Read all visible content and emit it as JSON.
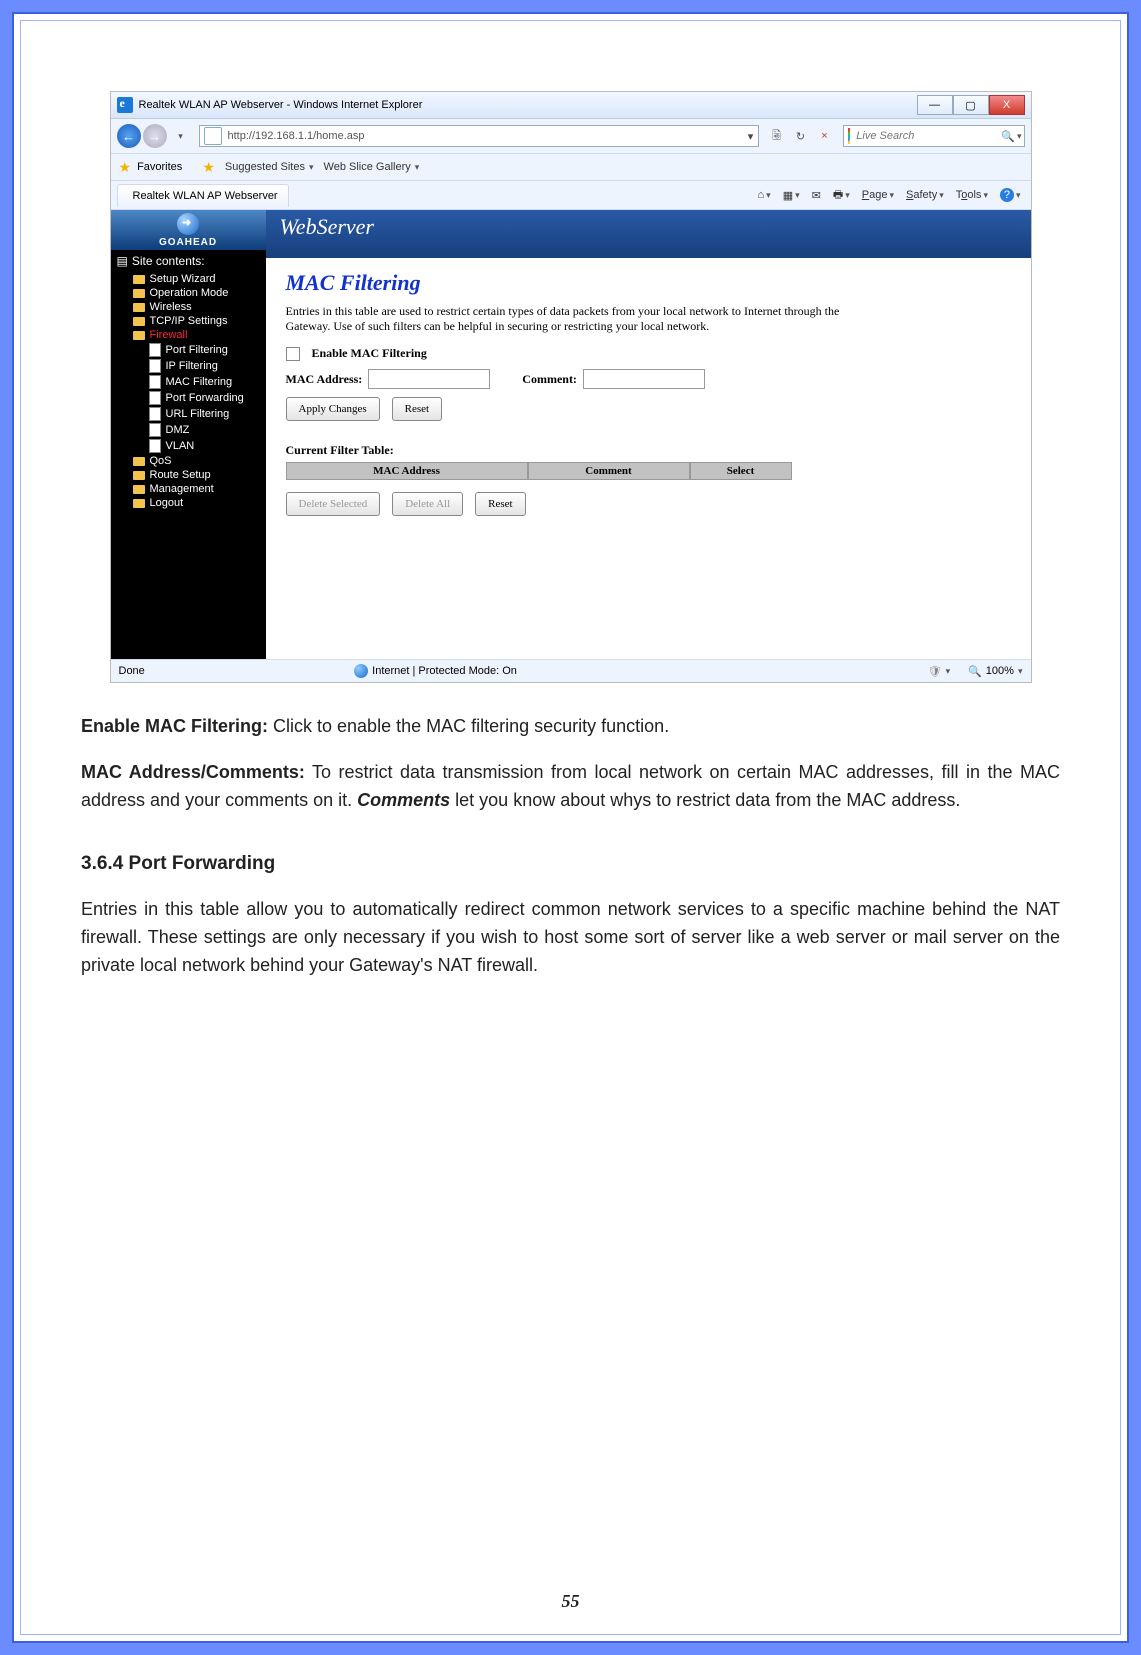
{
  "window": {
    "title": "Realtek WLAN AP Webserver - Windows Internet Explorer",
    "minimize": "—",
    "maximize": "▢",
    "close": "X"
  },
  "nav": {
    "back": "←",
    "forward": "→",
    "url": "http://192.168.1.1/home.asp",
    "dropdown": "▾",
    "compat": "🗟",
    "refresh": "↻",
    "stop": "×",
    "search_placeholder": "Live Search",
    "search_go": "🔍"
  },
  "favbar": {
    "favorites": "Favorites",
    "suggested": "Suggested Sites",
    "webslice": "Web Slice Gallery"
  },
  "tab": {
    "title": "Realtek WLAN AP Webserver"
  },
  "cmdbar": {
    "home": "⌂",
    "feeds": "▦",
    "mail": "✉",
    "print": "🖶",
    "page": "Page",
    "safety": "Safety",
    "tools": "Tools",
    "help": "?"
  },
  "sidebar": {
    "brand": "GOAHEAD",
    "title": "Site contents:",
    "items": [
      "Setup Wizard",
      "Operation Mode",
      "Wireless",
      "TCP/IP Settings"
    ],
    "firewall": "Firewall",
    "firewall_items": [
      "Port Filtering",
      "IP Filtering",
      "MAC Filtering",
      "Port Forwarding",
      "URL Filtering",
      "DMZ",
      "VLAN"
    ],
    "items2": [
      "QoS",
      "Route Setup",
      "Management",
      "Logout"
    ]
  },
  "banner": "WebServer",
  "page": {
    "heading": "MAC Filtering",
    "intro": "Entries in this table are used to restrict certain types of data packets from your local network to Internet through the Gateway. Use of such filters can be helpful in securing or restricting your local network.",
    "enable": "Enable MAC Filtering",
    "mac_label": "MAC Address:",
    "comment_label": "Comment:",
    "apply": "Apply Changes",
    "reset": "Reset",
    "table_title": "Current Filter Table:",
    "col1": "MAC Address",
    "col2": "Comment",
    "col3": "Select",
    "del_sel": "Delete Selected",
    "del_all": "Delete All",
    "reset2": "Reset"
  },
  "statusbar": {
    "left": "Done",
    "center": "Internet | Protected Mode: On",
    "zoom": "100%"
  },
  "doc": {
    "p1a": "Enable MAC Filtering:",
    "p1b": " Click to enable the MAC filtering security function.",
    "p2a": "MAC Address/Comments:",
    "p2b": " To restrict data transmission from local network on certain MAC addresses, fill in the MAC address and your comments on it. ",
    "p2c": "Comments",
    "p2d": " let you know about whys to restrict data from the MAC address.",
    "h3": "3.6.4  Port Forwarding",
    "p3": "Entries in this table allow you to automatically redirect common network services to a specific machine behind the NAT firewall. These settings are only necessary if you wish to host some sort of server like a web server or mail server on the private local network behind your Gateway's NAT firewall."
  },
  "page_number": "55"
}
